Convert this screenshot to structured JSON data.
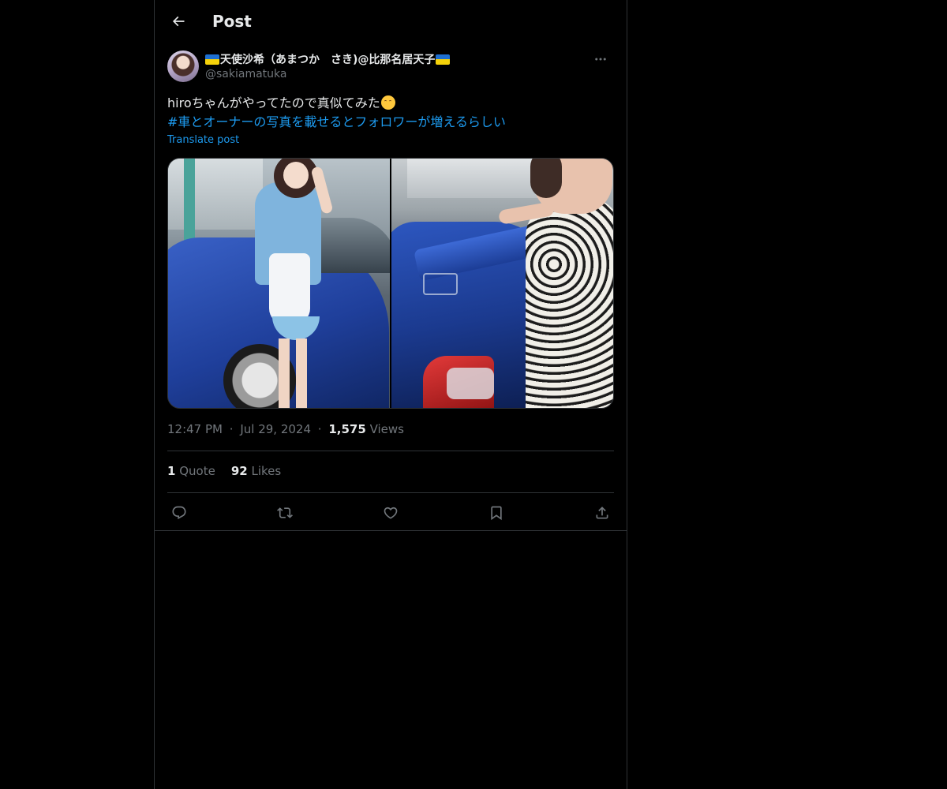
{
  "header": {
    "title": "Post",
    "back_icon": "arrow-left-icon"
  },
  "author": {
    "display_name": "天使沙希（あまつか　さき)@比那名居天子",
    "handle": "@sakiamatuka",
    "name_flags": [
      "ukraine-flag-icon",
      "ukraine-flag-icon"
    ]
  },
  "post": {
    "text": "hiroちゃんがやってたので真似てみた",
    "emoji": "hugging-face-emoji",
    "hashtag": "#車とオーナーの写真を載せるとフォロワーが増えるらしい",
    "translate_label": "Translate post",
    "media": [
      {
        "name": "photo-maid-with-car"
      },
      {
        "name": "photo-woman-with-car-spoiler"
      }
    ]
  },
  "meta": {
    "time": "12:47 PM",
    "separator": "·",
    "date": "Jul 29, 2024",
    "views_count": "1,575",
    "views_label": "Views"
  },
  "stats": {
    "quote_count": "1",
    "quote_label": "Quote",
    "likes_count": "92",
    "likes_label": "Likes"
  },
  "actions": [
    "reply-icon",
    "repost-icon",
    "like-icon",
    "bookmark-icon",
    "share-icon"
  ],
  "colors": {
    "background": "#000000",
    "text": "#e7e9ea",
    "secondary": "#71767b",
    "link": "#1d9bf0",
    "border": "#2f3336"
  }
}
